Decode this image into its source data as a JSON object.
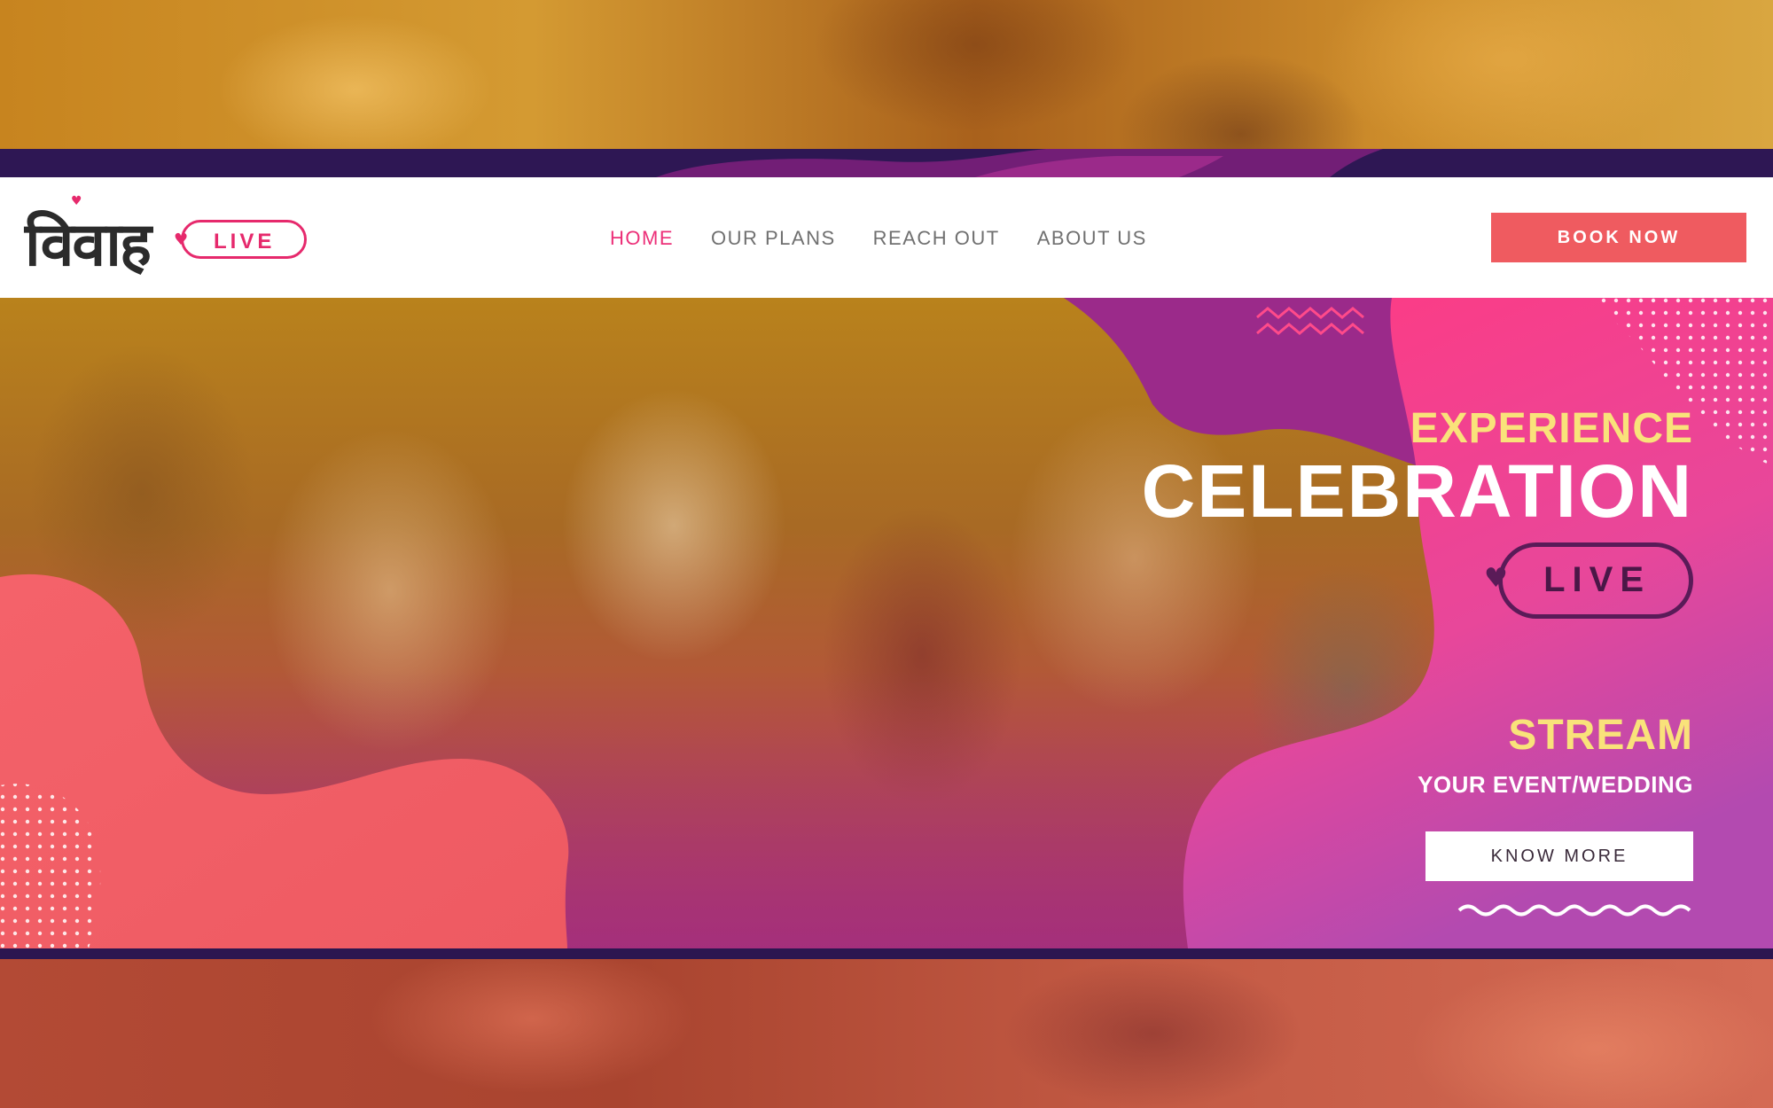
{
  "logo": {
    "devanagari": "विवाह",
    "badge": "LIVE"
  },
  "nav": {
    "items": [
      {
        "label": "HOME",
        "active": true
      },
      {
        "label": "OUR PLANS",
        "active": false
      },
      {
        "label": "REACH OUT",
        "active": false
      },
      {
        "label": "ABOUT US",
        "active": false
      }
    ]
  },
  "header": {
    "book_label": "BOOK NOW"
  },
  "hero": {
    "line1": "EXPERIENCE",
    "line2": "CELEBRATION",
    "badge": "LIVE",
    "line3": "STREAM",
    "line4": "YOUR EVENT/WEDDING",
    "cta_label": "KNOW MORE"
  },
  "colors": {
    "brand_pink": "#ec2f78",
    "coral": "#ef5b60",
    "purple": "#9b2a8a",
    "dark_purple": "#2c1650",
    "yellow": "#f9e27a"
  },
  "icons": [
    "heart-icon",
    "zigzag-decoration",
    "dot-pattern",
    "wave-decoration"
  ]
}
